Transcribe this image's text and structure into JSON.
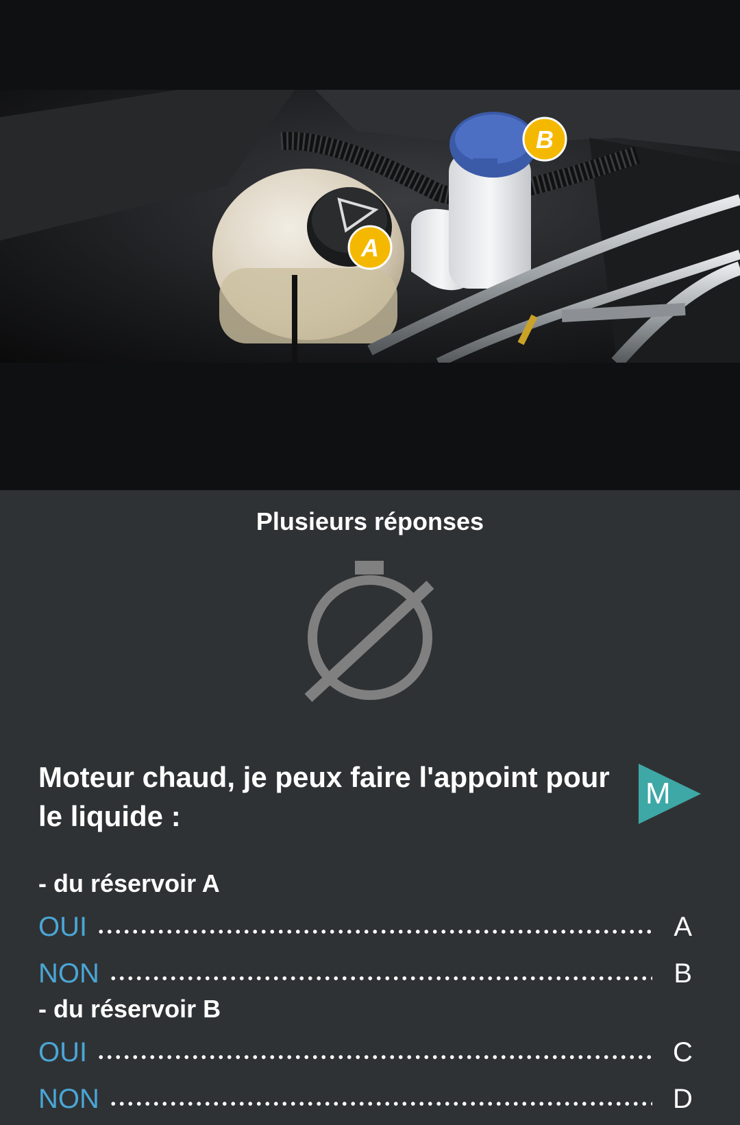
{
  "question_panel": {
    "mode_title": "Plusieurs réponses",
    "question": "Moteur chaud, je peux faire l'appoint pour le liquide :",
    "audio_button_letter": "M",
    "accent_color": "#4aa6d6",
    "play_color": "#3ea8a6",
    "timer_icon": "timer-off-icon",
    "sections": [
      {
        "label": "- du réservoir A",
        "answers": [
          {
            "label": "OUI",
            "key": "A"
          },
          {
            "label": "NON",
            "key": "B"
          }
        ]
      },
      {
        "label": "- du réservoir B",
        "answers": [
          {
            "label": "OUI",
            "key": "C"
          },
          {
            "label": "NON",
            "key": "D"
          }
        ]
      }
    ]
  },
  "photo": {
    "badge_a": "A",
    "badge_b": "B"
  }
}
